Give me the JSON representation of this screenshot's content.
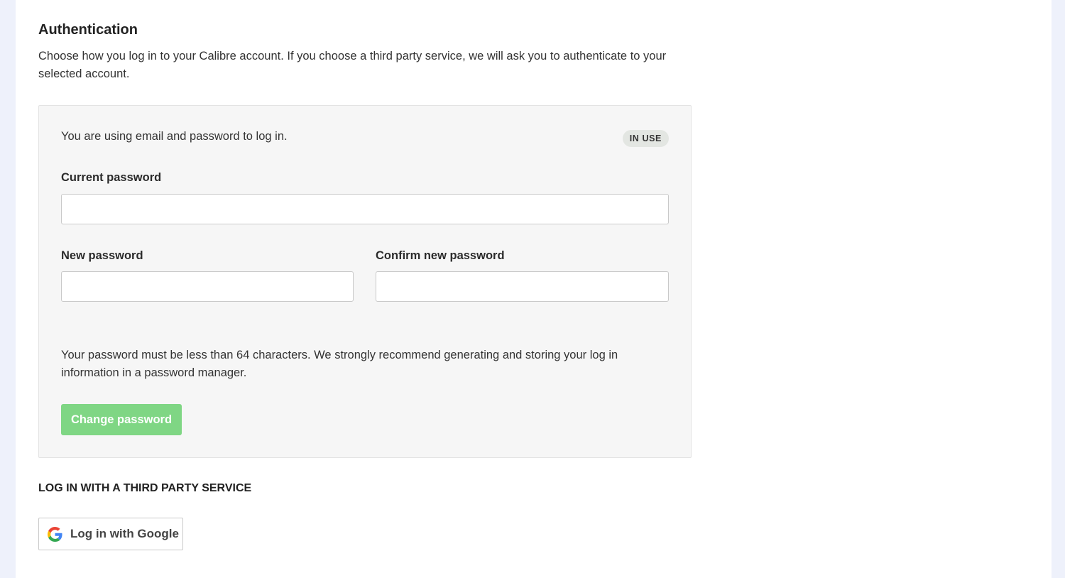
{
  "section": {
    "title": "Authentication",
    "description": "Choose how you log in to your Calibre account. If you choose a third party service, we will ask you to authenticate to your selected account."
  },
  "email_auth": {
    "status_text": "You are using email and password to log in.",
    "badge": "IN USE",
    "current_password": {
      "label": "Current password",
      "value": "",
      "placeholder": ""
    },
    "new_password": {
      "label": "New password",
      "value": "",
      "placeholder": ""
    },
    "confirm_password": {
      "label": "Confirm new password",
      "value": "",
      "placeholder": ""
    },
    "help_text": "Your password must be less than 64 characters. We strongly recommend generating and storing your log in information in a password manager.",
    "submit_label": "Change password"
  },
  "third_party": {
    "heading": "LOG IN WITH A THIRD PARTY SERVICE",
    "google_label": "Log in with Google",
    "google_icon": "google-icon"
  },
  "colors": {
    "page_background": "#eef1fb",
    "panel_background": "#f6f6f6",
    "primary_button": "#7fd684",
    "badge_background": "#e3e6e2"
  }
}
